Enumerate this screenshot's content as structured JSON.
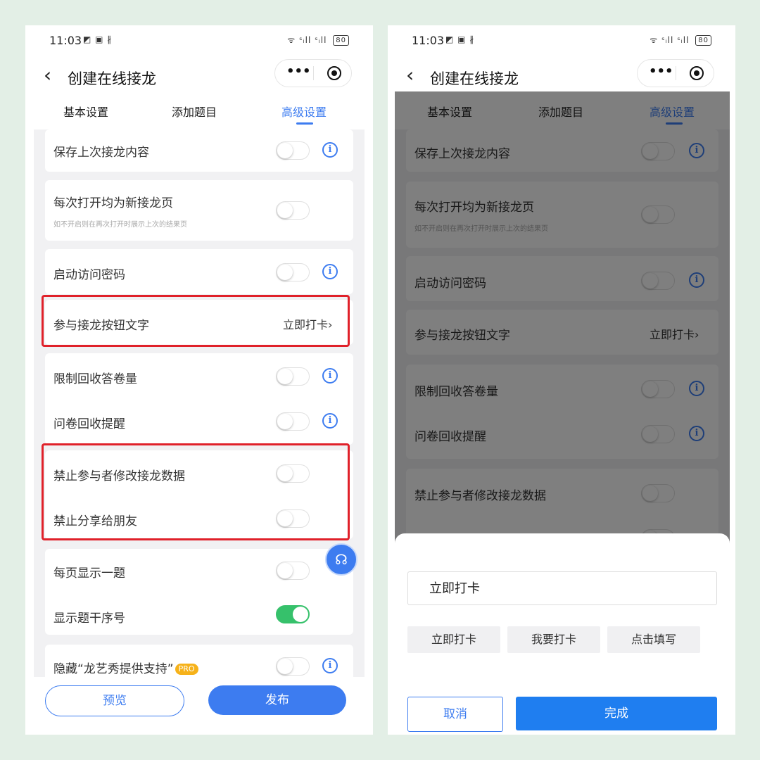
{
  "statusbar": {
    "time": "11:03",
    "sys_icons": "◩ ▣ ∦",
    "right_icons": "ᯤ ˢᵢll ˢᵢll",
    "battery": "80"
  },
  "nav": {
    "title": "创建在线接龙",
    "more_icon": "•••"
  },
  "tabs": [
    {
      "label": "基本设置"
    },
    {
      "label": "添加题目"
    },
    {
      "label": "高级设置",
      "active": true
    }
  ],
  "settings": {
    "save_last": "保存上次接龙内容",
    "new_page": "每次打开均为新接龙页",
    "new_page_sub": "如不开启则在再次打开时展示上次的结果页",
    "password": "启动访问密码",
    "button_text": "参与接龙按钮文字",
    "button_text_value": "立即打卡",
    "limit_count": "限制回收答卷量",
    "reminder": "问卷回收提醒",
    "no_edit": "禁止参与者修改接龙数据",
    "no_share": "禁止分享给朋友",
    "one_per_page": "每页显示一题",
    "show_number": "显示题干序号",
    "hide_support": "隐藏“龙艺秀提供支持”",
    "pro_badge": "PRO"
  },
  "toggles": {
    "save_last": false,
    "new_page": false,
    "password": false,
    "limit_count": false,
    "reminder": false,
    "no_edit": false,
    "no_share": false,
    "one_per_page": false,
    "show_number": true,
    "hide_support": false
  },
  "bottom": {
    "preview": "预览",
    "publish": "发布"
  },
  "sheet": {
    "input_value": "立即打卡",
    "options": [
      "立即打卡",
      "我要打卡",
      "点击填写"
    ],
    "cancel": "取消",
    "done": "完成"
  },
  "icons": {
    "info": "i",
    "back": "‹",
    "chevron": "›",
    "float": "☊"
  },
  "colors": {
    "accent": "#3d7cf0",
    "highlight": "#e0212a",
    "toggle_on": "#36c16b",
    "background": "#e3efe6"
  }
}
